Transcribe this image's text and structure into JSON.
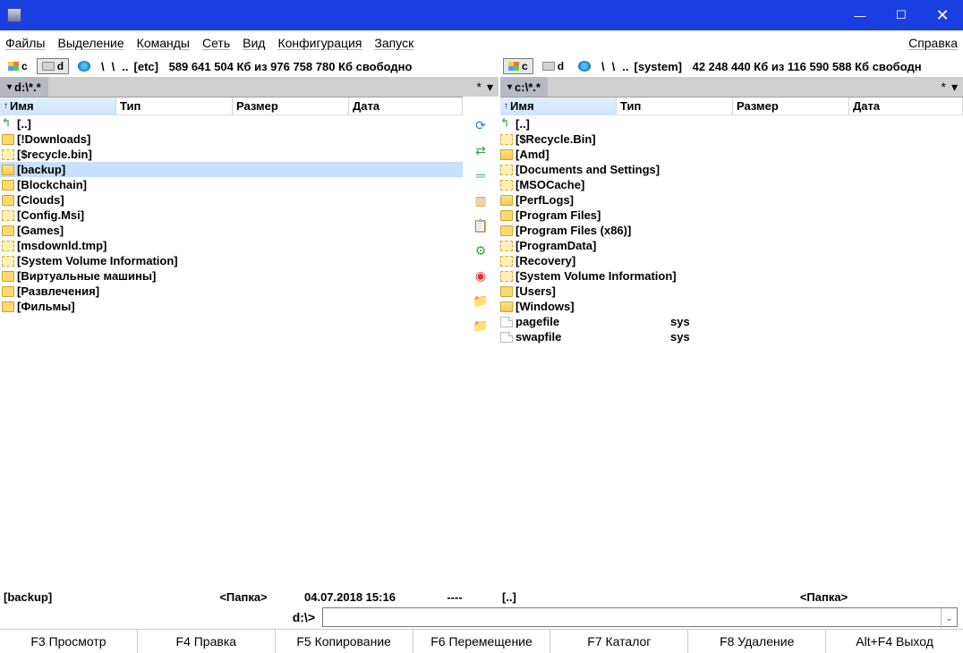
{
  "title": "",
  "winbtns": {
    "min": "—",
    "max": "☐",
    "close": "✕"
  },
  "menu": {
    "files": "Файлы",
    "select": "Выделение",
    "commands": "Команды",
    "net": "Сеть",
    "view": "Вид",
    "config": "Конфигурация",
    "launch": "Запуск",
    "help": "Справка"
  },
  "drivebar": {
    "left": {
      "c": "c",
      "d": "d",
      "backslash": "\\",
      "etc": "[etc]",
      "free": "589 641 504 Кб из 976 758 780 Кб свободно",
      "dots": ".."
    },
    "right": {
      "c": "c",
      "d": "d",
      "backslash": "\\",
      "system": "[system]",
      "free": "42 248 440 Кб из 116 590 588 Кб свободн",
      "dots": ".."
    }
  },
  "tabs": {
    "left": "d:\\*.*",
    "right": "c:\\*.*",
    "star": "*",
    "arrow": "▾"
  },
  "columns": {
    "name": "Имя",
    "type": "Тип",
    "size": "Размер",
    "date": "Дата",
    "arrow": "↑"
  },
  "left_files": [
    {
      "icon": "updir",
      "name": "[..]"
    },
    {
      "icon": "folder",
      "name": "[!Downloads]"
    },
    {
      "icon": "folder hidden",
      "name": "[$recycle.bin]"
    },
    {
      "icon": "folder open",
      "name": "[backup]",
      "sel": true
    },
    {
      "icon": "folder",
      "name": "[Blockchain]"
    },
    {
      "icon": "folder",
      "name": "[Clouds]"
    },
    {
      "icon": "folder hidden",
      "name": "[Config.Msi]"
    },
    {
      "icon": "folder",
      "name": "[Games]"
    },
    {
      "icon": "folder hidden",
      "name": "[msdownld.tmp]"
    },
    {
      "icon": "folder hidden",
      "name": "[System Volume Information]"
    },
    {
      "icon": "folder",
      "name": "[Виртуальные машины]"
    },
    {
      "icon": "folder",
      "name": "[Развлечения]"
    },
    {
      "icon": "folder",
      "name": "[Фильмы]"
    }
  ],
  "right_files": [
    {
      "icon": "updir",
      "name": "[..]"
    },
    {
      "icon": "folder hidden",
      "name": "[$Recycle.Bin]"
    },
    {
      "icon": "folder open",
      "name": "[Amd]"
    },
    {
      "icon": "folder hidden",
      "name": "[Documents and Settings]"
    },
    {
      "icon": "folder hidden",
      "name": "[MSOCache]"
    },
    {
      "icon": "folder open",
      "name": "[PerfLogs]"
    },
    {
      "icon": "folder",
      "name": "[Program Files]"
    },
    {
      "icon": "folder",
      "name": "[Program Files (x86)]"
    },
    {
      "icon": "folder hidden",
      "name": "[ProgramData]"
    },
    {
      "icon": "folder hidden",
      "name": "[Recovery]"
    },
    {
      "icon": "folder hidden",
      "name": "[System Volume Information]"
    },
    {
      "icon": "folder",
      "name": "[Users]"
    },
    {
      "icon": "folder open",
      "name": "[Windows]"
    },
    {
      "icon": "file",
      "name": "pagefile",
      "ext": "sys"
    },
    {
      "icon": "file",
      "name": "swapfile",
      "ext": "sys"
    }
  ],
  "vt": [
    {
      "name": "refresh-icon",
      "glyph": "⟳",
      "color": "#2a7ad4"
    },
    {
      "name": "swap-icon",
      "glyph": "⇄",
      "color": "#2e9e4f"
    },
    {
      "name": "equal-icon",
      "glyph": "═",
      "color": "#4a7"
    },
    {
      "name": "compare-icon",
      "glyph": "▥",
      "color": "#c94"
    },
    {
      "name": "copy-icon",
      "glyph": "📋",
      "color": "#c44"
    },
    {
      "name": "sync-icon",
      "glyph": "⚙",
      "color": "#3a3"
    },
    {
      "name": "chrome-icon",
      "glyph": "◉",
      "color": "#d33"
    },
    {
      "name": "folder1-icon",
      "glyph": "📁",
      "color": "#e5a93a"
    },
    {
      "name": "folder2-icon",
      "glyph": "📁",
      "color": "#e5a93a"
    }
  ],
  "status": {
    "left": {
      "name": "[backup]",
      "size": "<Папка>",
      "date": "04.07.2018 15:16",
      "dash": "----"
    },
    "right": {
      "name": "[..]",
      "size": "<Папка>",
      "date": "",
      "dash": ""
    }
  },
  "cmd": {
    "prompt": "d:\\>"
  },
  "fkeys": {
    "f3": "F3 Просмотр",
    "f4": "F4 Правка",
    "f5": "F5 Копирование",
    "f6": "F6 Перемещение",
    "f7": "F7 Каталог",
    "f8": "F8 Удаление",
    "altf4": "Alt+F4 Выход"
  }
}
